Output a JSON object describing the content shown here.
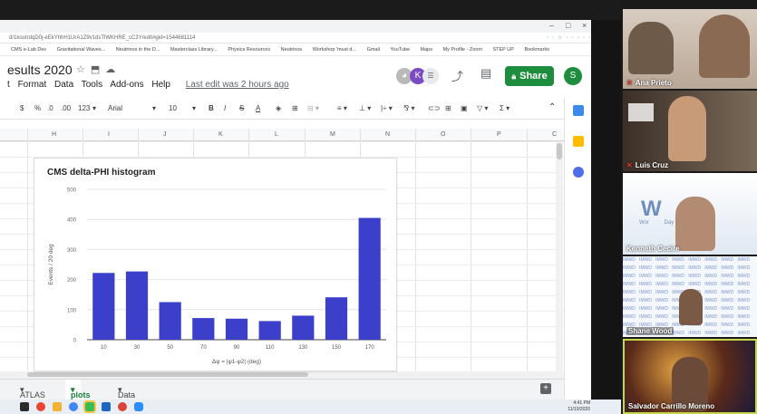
{
  "browser": {
    "url": "d/1kouIrdqD0j-eEkYhhH1UrA1Z9v1dsTlWKHRE_cC3Y/edit#gid=1544681114",
    "bookmarks": [
      "CMS e-Lab Dev",
      "Gravitational Waves...",
      "Neutrinos in the D...",
      "Masterclass Library...",
      "Physics Resources",
      "Neutrinos",
      "Workshop 'must d...",
      "Gmail",
      "YouTube",
      "Maps",
      "My Profile - Zoom",
      "STEP UP",
      "Bookmarks"
    ],
    "window_controls": [
      "–",
      "□",
      "×"
    ]
  },
  "doc": {
    "title": "esults 2020",
    "menus": [
      "t",
      "Format",
      "Data",
      "Tools",
      "Add-ons",
      "Help"
    ],
    "last_edit": "Last edit was 2 hours ago",
    "share_label": "Share",
    "user_initial": "S",
    "collab_initial": "K"
  },
  "toolbar": {
    "currency": "$",
    "percent": "%",
    "dec_less": ".0",
    "dec_more": ".00",
    "format_more": "123",
    "font": "Arial",
    "font_size": "10",
    "bold": "B",
    "italic": "I",
    "strike": "S",
    "text_color": "A"
  },
  "grid": {
    "columns": [
      "H",
      "I",
      "J",
      "K",
      "L",
      "M",
      "N",
      "O",
      "P",
      "C"
    ]
  },
  "chart_data": {
    "type": "bar",
    "title": "CMS delta-PHI histogram",
    "xlabel": "Δφ = |φ1-φ2| (deg)",
    "ylabel": "Events / 20 deg",
    "categories": [
      "10",
      "30",
      "50",
      "70",
      "90",
      "110",
      "130",
      "150",
      "170"
    ],
    "values": [
      222,
      227,
      125,
      72,
      70,
      62,
      80,
      141,
      405
    ],
    "ylim": [
      0,
      500
    ],
    "yticks": [
      0,
      100,
      200,
      300,
      400,
      500
    ],
    "bar_color": "#3b3fc9",
    "grid": true
  },
  "sheet_tabs": {
    "tabs": [
      "ATLAS",
      "plots",
      "Data Claims"
    ],
    "active": "plots"
  },
  "clock": {
    "time": "4:41 PM",
    "date": "11/10/2020"
  },
  "participants": [
    {
      "name": "Ana Prieto",
      "muted": true
    },
    {
      "name": "Luis Cruz",
      "muted": true
    },
    {
      "name": "Kenneth Cecire",
      "muted": false
    },
    {
      "name": "Shane Wood",
      "muted": false
    },
    {
      "name": "Salvador Carrillo Moreno",
      "muted": false
    }
  ],
  "participant_bg_text": {
    "kenneth": "W    2",
    "kenneth_sub": "Wor          Day",
    "shane_pattern": "IMWD"
  },
  "colors": {
    "share_green": "#1e8e3e",
    "accent_blue": "#1a73e8",
    "highlight_border": "#c6d64a"
  }
}
